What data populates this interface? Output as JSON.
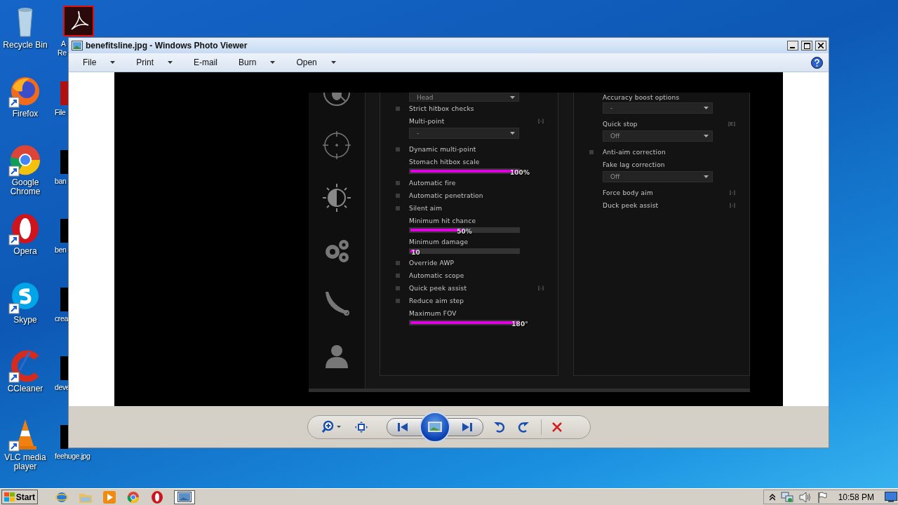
{
  "desktop_icons": [
    {
      "label": "Recycle Bin"
    },
    {
      "label": "Firefox"
    },
    {
      "label": "Google Chrome"
    },
    {
      "label": "Opera"
    },
    {
      "label": "Skype"
    },
    {
      "label": "CCleaner"
    },
    {
      "label": "VLC media player"
    }
  ],
  "desktop_icons_partial": [
    {
      "lines": [
        "A",
        "Re"
      ]
    },
    {
      "lines": [
        "File"
      ]
    },
    {
      "lines": [
        "ban"
      ]
    },
    {
      "lines": [
        "ben"
      ]
    },
    {
      "lines": [
        "crea"
      ]
    },
    {
      "lines": [
        "deve"
      ]
    },
    {
      "lines": [
        "feehuge.jpg"
      ]
    }
  ],
  "window": {
    "title": "benefitsline.jpg - Windows Photo Viewer",
    "menu": [
      {
        "label": "File",
        "dropdown": true
      },
      {
        "label": "Print",
        "dropdown": true
      },
      {
        "label": "E-mail",
        "dropdown": false
      },
      {
        "label": "Burn",
        "dropdown": true
      },
      {
        "label": "Open",
        "dropdown": true
      }
    ],
    "image": {
      "left_settings": [
        {
          "kind": "dropdown",
          "value": "Head"
        },
        {
          "kind": "checkbox",
          "label": "Strict hitbox checks",
          "checked": false
        },
        {
          "kind": "label",
          "label": "Multi-point",
          "key": "[-]"
        },
        {
          "kind": "dropdown",
          "value": "-"
        },
        {
          "kind": "checkbox",
          "label": "Dynamic multi-point",
          "checked": false
        },
        {
          "kind": "label",
          "label": "Stomach hitbox scale"
        },
        {
          "kind": "slider",
          "level": 1,
          "reading": "100%"
        },
        {
          "kind": "checkbox",
          "label": "Automatic fire",
          "checked": false
        },
        {
          "kind": "checkbox",
          "label": "Automatic penetration",
          "checked": false
        },
        {
          "kind": "checkbox",
          "label": "Silent aim",
          "checked": false
        },
        {
          "kind": "label",
          "label": "Minimum hit chance"
        },
        {
          "kind": "slider",
          "level": 0.5,
          "reading": "50%"
        },
        {
          "kind": "label",
          "label": "Minimum damage"
        },
        {
          "kind": "slider",
          "level": 0.06,
          "reading": "10"
        },
        {
          "kind": "checkbox",
          "label": "Override AWP",
          "checked": false
        },
        {
          "kind": "checkbox",
          "label": "Automatic scope",
          "checked": false
        },
        {
          "kind": "checkbox",
          "label": "Quick peek assist",
          "checked": false,
          "key": "[-]"
        },
        {
          "kind": "checkbox",
          "label": "Reduce aim step",
          "checked": false
        },
        {
          "kind": "label",
          "label": "Maximum FOV"
        },
        {
          "kind": "slider",
          "level": 1,
          "reading": "180°"
        }
      ],
      "right_settings": [
        {
          "kind": "label",
          "label": "Accuracy boost options"
        },
        {
          "kind": "dropdown",
          "value": "-"
        },
        {
          "kind": "label",
          "label": "Quick stop",
          "key": "[E]"
        },
        {
          "kind": "dropdown",
          "value": "Off"
        },
        {
          "kind": "checkbox",
          "label": "Anti-aim correction",
          "checked": false
        },
        {
          "kind": "label",
          "label": "Fake lag correction"
        },
        {
          "kind": "dropdown",
          "value": "Off"
        },
        {
          "kind": "label",
          "label": "Force body aim",
          "key": "[-]"
        },
        {
          "kind": "label",
          "label": "Duck peek assist",
          "key": "[-]"
        }
      ]
    }
  },
  "taskbar": {
    "start": "Start",
    "clock": "10:58 PM"
  }
}
